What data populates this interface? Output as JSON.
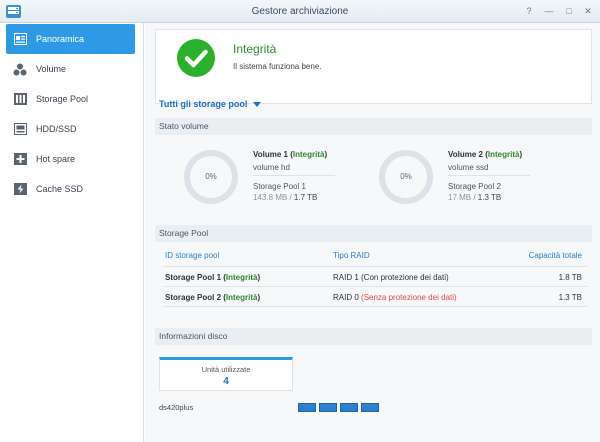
{
  "window": {
    "title": "Gestore archiviazione",
    "controls": [
      "?",
      "—",
      "□",
      "✕"
    ]
  },
  "sidebar": {
    "items": [
      {
        "label": "Panoramica",
        "icon": "overview-icon",
        "active": true
      },
      {
        "label": "Volume",
        "icon": "volume-icon"
      },
      {
        "label": "Storage Pool",
        "icon": "storage-pool-icon"
      },
      {
        "label": "HDD/SSD",
        "icon": "hdd-icon"
      },
      {
        "label": "Hot spare",
        "icon": "hot-spare-icon"
      },
      {
        "label": "Cache SSD",
        "icon": "cache-ssd-icon"
      }
    ]
  },
  "health": {
    "title": "Integrità",
    "subtitle": "Il sistema funziona bene.",
    "color": "#2bb02b"
  },
  "filter": {
    "label": "Tutti gli storage pool"
  },
  "volume_section": {
    "title": "Stato volume",
    "volumes": [
      {
        "percent": "0%",
        "name": "Volume 1",
        "status": "Integrità",
        "desc": "volume hd",
        "pool": "Storage Pool 1",
        "used": "143.8 MB",
        "total": "1.7 TB"
      },
      {
        "percent": "0%",
        "name": "Volume 2",
        "status": "Integrità",
        "desc": "volume ssd",
        "pool": "Storage Pool 2",
        "used": "17 MB",
        "total": "1.3 TB"
      }
    ]
  },
  "pool_section": {
    "title": "Storage Pool",
    "headers": {
      "id": "ID storage pool",
      "raid": "Tipo RAID",
      "capacity": "Capacità totale"
    },
    "rows": [
      {
        "name": "Storage Pool 1",
        "status": "Integrità",
        "raid": "RAID 1",
        "raid_note": "(Con protezione dei dati)",
        "capacity": "1.8 TB"
      },
      {
        "name": "Storage Pool 2",
        "status": "Integrità",
        "raid": "RAID 0",
        "raid_note": "(Senza protezione dei dati)",
        "capacity": "1.3 TB"
      }
    ]
  },
  "disk_section": {
    "title": "Informazioni disco",
    "used_label": "Unità utilizzate",
    "used_value": "4",
    "device": "ds420plus",
    "bay_count": 4
  },
  "colors": {
    "accent": "#2e9ae6",
    "ok": "#2e8b2e",
    "warn": "#e04a4a"
  }
}
